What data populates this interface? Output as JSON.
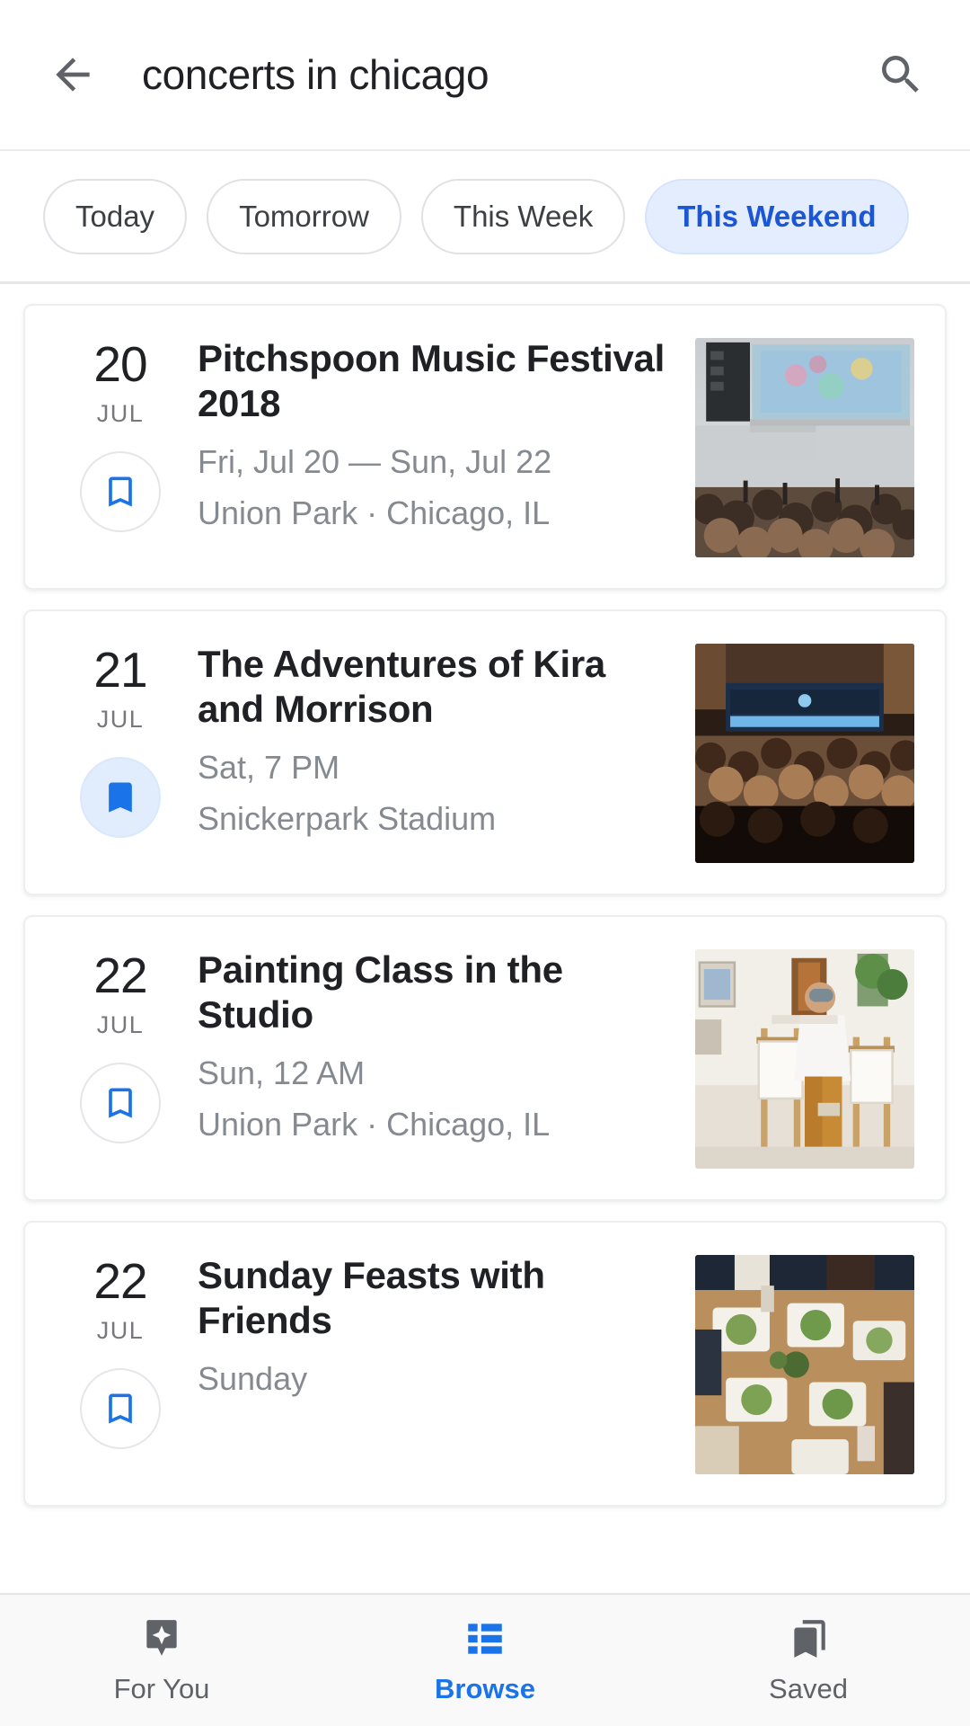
{
  "search": {
    "query": "concerts in chicago",
    "back_icon": "arrow-left-icon",
    "search_icon": "search-icon"
  },
  "filters": {
    "chips": [
      {
        "label": "Today",
        "active": false
      },
      {
        "label": "Tomorrow",
        "active": false
      },
      {
        "label": "This Week",
        "active": false
      },
      {
        "label": "This Weekend",
        "active": true
      }
    ]
  },
  "colors": {
    "accent": "#1a73e8",
    "chip_active_bg": "#e4edfd",
    "chip_active_text": "#1a56d6",
    "saved_bg": "#e1ecfd",
    "text_primary": "#202124",
    "text_secondary": "#858a90"
  },
  "events": [
    {
      "day": "20",
      "month": "JUL",
      "title": "Pitchspoon Music Festival 2018",
      "when": "Fri, Jul 20 — Sun, Jul 22",
      "where": "Union Park · Chicago, IL",
      "saved": false,
      "bookmark_icon": "bookmark-outline-icon",
      "thumbnail": "concert-crowd-stage-photo"
    },
    {
      "day": "21",
      "month": "JUL",
      "title": "The Adventures of Kira and Morrison",
      "when": "Sat, 7 PM",
      "where": "Snickerpark Stadium",
      "saved": true,
      "bookmark_icon": "bookmark-filled-icon",
      "thumbnail": "indoor-venue-audience-photo"
    },
    {
      "day": "22",
      "month": "JUL",
      "title": "Painting Class in the Studio",
      "when": "Sun, 12 AM",
      "where": "Union Park · Chicago, IL",
      "saved": false,
      "bookmark_icon": "bookmark-outline-icon",
      "thumbnail": "painting-studio-easel-photo"
    },
    {
      "day": "22",
      "month": "JUL",
      "title": "Sunday Feasts with Friends",
      "when": "Sunday",
      "where": "",
      "saved": false,
      "bookmark_icon": "bookmark-outline-icon",
      "thumbnail": "dinner-table-food-photo"
    }
  ],
  "bottom_nav": [
    {
      "label": "For You",
      "icon": "sparkle-bubble-icon",
      "active": false
    },
    {
      "label": "Browse",
      "icon": "list-icon",
      "active": true
    },
    {
      "label": "Saved",
      "icon": "bookmarks-icon",
      "active": false
    }
  ]
}
